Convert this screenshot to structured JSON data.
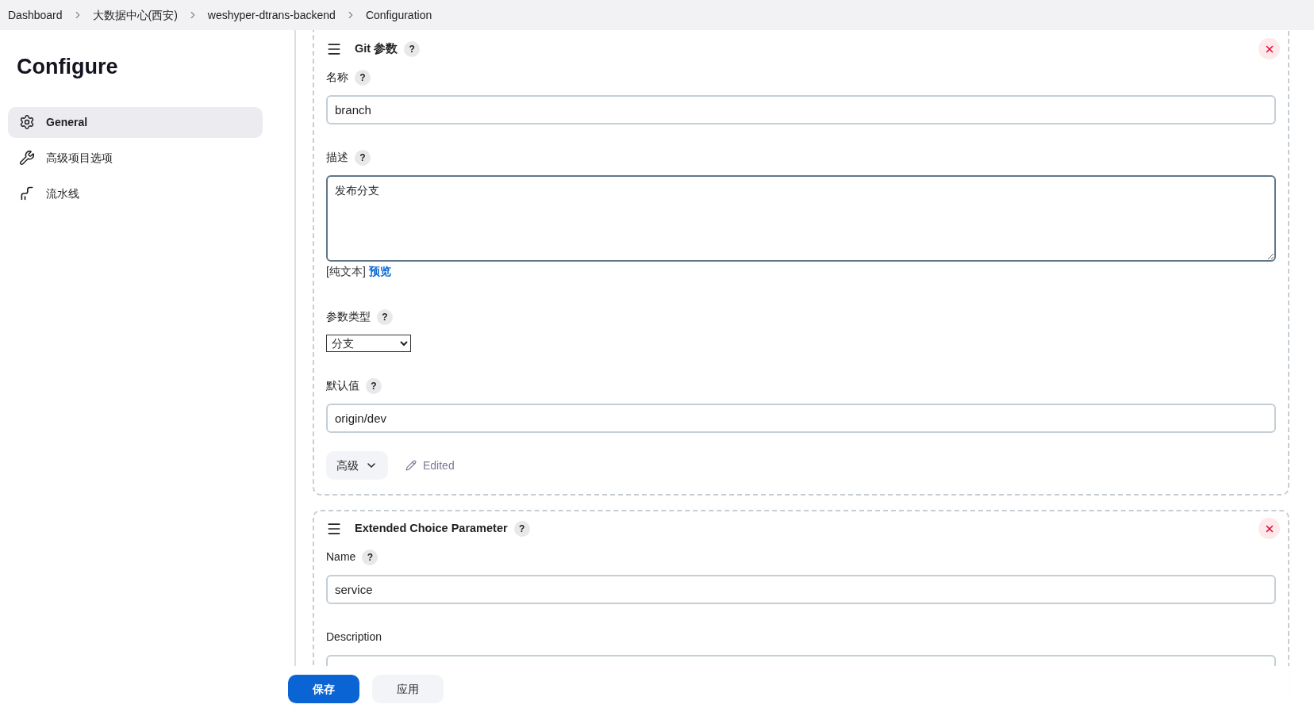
{
  "breadcrumbs": [
    "Dashboard",
    "大数据中心(西安)",
    "weshyper-dtrans-backend",
    "Configuration"
  ],
  "sidebar": {
    "title": "Configure",
    "items": [
      {
        "label": "General",
        "kind": "gear",
        "selected": true
      },
      {
        "label": "高级项目选项",
        "kind": "wrench",
        "selected": false
      },
      {
        "label": "流水线",
        "kind": "pipeline",
        "selected": false
      }
    ]
  },
  "parameters": [
    {
      "title": "Git 参数",
      "help": "?",
      "fields": [
        {
          "kind": "text",
          "label": "名称",
          "help": "?",
          "value": "branch"
        },
        {
          "kind": "textarea",
          "label": "描述",
          "help": "?",
          "value": "发布分支",
          "format": "[纯文本]",
          "preview": "预览"
        },
        {
          "kind": "select",
          "label": "参数类型",
          "help": "?",
          "value": "分支"
        },
        {
          "kind": "text",
          "label": "默认值",
          "help": "?",
          "value": "origin/dev"
        }
      ],
      "advanced": "高级",
      "status": "Edited"
    },
    {
      "title": "Extended Choice Parameter",
      "help": "?",
      "fields": [
        {
          "kind": "text",
          "label": "Name",
          "help": "?",
          "value": "service"
        },
        {
          "kind": "textarea",
          "label": "Description"
        }
      ]
    }
  ],
  "buttons": {
    "save": "保存",
    "apply": "应用"
  }
}
